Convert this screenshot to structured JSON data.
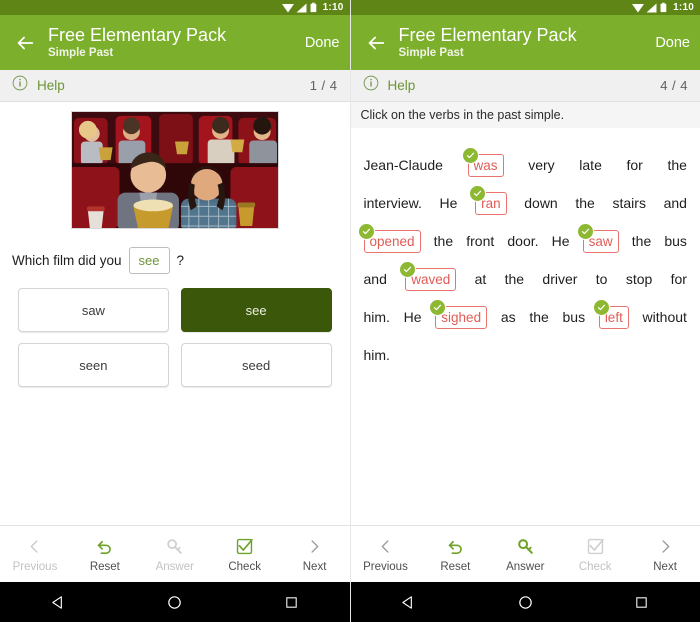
{
  "statusbar": {
    "time": "1:10",
    "icons": [
      "wifi-icon",
      "signal-icon",
      "battery-icon"
    ]
  },
  "appbar": {
    "back_icon": "back-arrow-icon",
    "title": "Free Elementary Pack",
    "subtitle": "Simple Past",
    "done_label": "Done"
  },
  "helpbar": {
    "info_icon": "info-icon",
    "help_label": "Help",
    "counter_left": "1 / 4",
    "counter_right": "4 / 4"
  },
  "left": {
    "photo_alt": "cinema-audience-photo",
    "question_prefix": "Which film did you",
    "blank_value": "see",
    "question_suffix": "?",
    "options": [
      "saw",
      "see",
      "seen",
      "seed"
    ],
    "selected_option": "see"
  },
  "right": {
    "instruction": "Click on the verbs in the past simple.",
    "lines": [
      [
        {
          "t": "Jean-Claude",
          "tag": false
        },
        {
          "t": "was",
          "tag": true
        },
        {
          "t": "very",
          "tag": false
        },
        {
          "t": "late",
          "tag": false
        },
        {
          "t": "for",
          "tag": false
        },
        {
          "t": "the",
          "tag": false
        }
      ],
      [
        {
          "t": "interview.",
          "tag": false
        },
        {
          "t": "He",
          "tag": false
        },
        {
          "t": "ran",
          "tag": true
        },
        {
          "t": "down",
          "tag": false
        },
        {
          "t": "the",
          "tag": false
        },
        {
          "t": "stairs",
          "tag": false
        },
        {
          "t": "and",
          "tag": false
        }
      ],
      [
        {
          "t": "opened",
          "tag": true
        },
        {
          "t": "the",
          "tag": false
        },
        {
          "t": "front",
          "tag": false
        },
        {
          "t": "door.",
          "tag": false
        },
        {
          "t": "He",
          "tag": false
        },
        {
          "t": "saw",
          "tag": true
        },
        {
          "t": "the",
          "tag": false
        },
        {
          "t": "bus",
          "tag": false
        }
      ],
      [
        {
          "t": "and",
          "tag": false
        },
        {
          "t": "waved",
          "tag": true
        },
        {
          "t": "at",
          "tag": false
        },
        {
          "t": "the",
          "tag": false
        },
        {
          "t": "driver",
          "tag": false
        },
        {
          "t": "to",
          "tag": false
        },
        {
          "t": "stop",
          "tag": false
        },
        {
          "t": "for",
          "tag": false
        }
      ],
      [
        {
          "t": "him.",
          "tag": false
        },
        {
          "t": "He",
          "tag": false
        },
        {
          "t": "sighed",
          "tag": true
        },
        {
          "t": "as",
          "tag": false
        },
        {
          "t": "the",
          "tag": false
        },
        {
          "t": "bus",
          "tag": false
        },
        {
          "t": "left",
          "tag": true
        },
        {
          "t": "without",
          "tag": false
        }
      ],
      [
        {
          "t": "him.",
          "tag": false
        }
      ]
    ],
    "tagged_words": [
      "was",
      "ran",
      "opened",
      "saw",
      "waved",
      "sighed",
      "left"
    ]
  },
  "toolbar": {
    "items": [
      {
        "label": "Previous",
        "icon": "chevron-left-icon"
      },
      {
        "label": "Reset",
        "icon": "undo-icon"
      },
      {
        "label": "Answer",
        "icon": "key-icon"
      },
      {
        "label": "Check",
        "icon": "checkbox-icon"
      },
      {
        "label": "Next",
        "icon": "chevron-right-icon"
      }
    ],
    "left_enabled": [
      "Reset",
      "Check",
      "Next"
    ],
    "right_enabled": [
      "Previous",
      "Reset",
      "Answer",
      "Next"
    ]
  },
  "navbar": {
    "back_icon": "nav-back-triangle-icon",
    "home_icon": "nav-home-circle-icon",
    "recents_icon": "nav-recents-square-icon"
  },
  "colors": {
    "statusbar_green": "#5E8516",
    "appbar_green": "#7CB02C",
    "accent_green": "#8cb832",
    "selected_dark_green": "#3B5709",
    "tag_red": "#e05c57",
    "disabled_grey": "#c2c2c2"
  }
}
